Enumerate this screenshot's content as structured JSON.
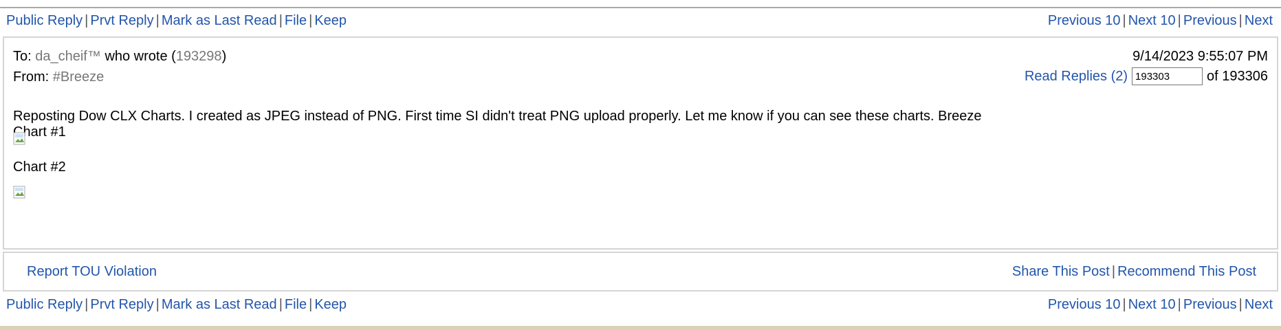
{
  "nav": {
    "public_reply": "Public Reply",
    "prvt_reply": "Prvt Reply",
    "mark_last_read": "Mark as Last Read",
    "file": "File",
    "keep": "Keep",
    "previous_10": "Previous 10",
    "next_10": "Next 10",
    "previous": "Previous",
    "next": "Next"
  },
  "post": {
    "to_label": "To:",
    "to_user": "da_cheif™",
    "wrote_label": "who wrote (",
    "wrote_msg": "193298",
    "wrote_close": ")",
    "from_label": "From:",
    "from_user": "#Breeze",
    "datetime": "9/14/2023 9:55:07 PM",
    "read_replies": "Read Replies (2)",
    "message_number": "193303",
    "of_label": "of 193306",
    "body_line1": "Reposting Dow CLX Charts. I created as JPEG instead of PNG. First time SI didn't treat PNG upload properly. Let me know if you can see these charts. Breeze",
    "body_line2": "Chart #1",
    "chart2_label": "Chart #2"
  },
  "footer": {
    "report": "Report TOU Violation",
    "share": "Share This Post",
    "recommend": "Recommend This Post"
  },
  "colors": {
    "link": "#2255aa",
    "border": "#d5d5d5",
    "bottom_band": "#d8d3b5"
  }
}
